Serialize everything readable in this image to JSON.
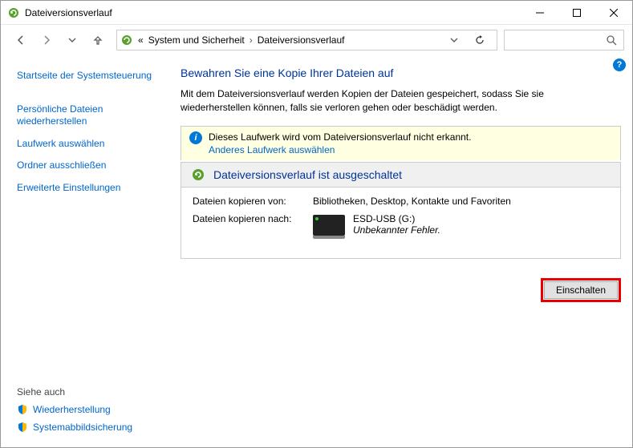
{
  "titlebar": {
    "title": "Dateiversionsverlauf"
  },
  "breadcrumb": {
    "prefix": "«",
    "seg1": "System und Sicherheit",
    "seg2": "Dateiversionsverlauf"
  },
  "sidebar": {
    "home": "Startseite der Systemsteuerung",
    "links": [
      "Persönliche Dateien wiederherstellen",
      "Laufwerk auswählen",
      "Ordner ausschließen",
      "Erweiterte Einstellungen"
    ],
    "see_also_heading": "Siehe auch",
    "see_also": [
      "Wiederherstellung",
      "Systemabbildsicherung"
    ]
  },
  "main": {
    "heading": "Bewahren Sie eine Kopie Ihrer Dateien auf",
    "description": "Mit dem Dateiversionsverlauf werden Kopien der Dateien gespeichert, sodass Sie sie wiederherstellen können, falls sie verloren gehen oder beschädigt werden.",
    "warning_text": "Dieses Laufwerk wird vom Dateiversionsverlauf nicht erkannt.",
    "warning_link": "Anderes Laufwerk auswählen",
    "panel_title": "Dateiversionsverlauf ist ausgeschaltet",
    "copy_from_label": "Dateien kopieren von:",
    "copy_from_value": "Bibliotheken, Desktop, Kontakte und Favoriten",
    "copy_to_label": "Dateien kopieren nach:",
    "drive_name": "ESD-USB (G:)",
    "drive_error": "Unbekannter Fehler.",
    "button_label": "Einschalten"
  }
}
